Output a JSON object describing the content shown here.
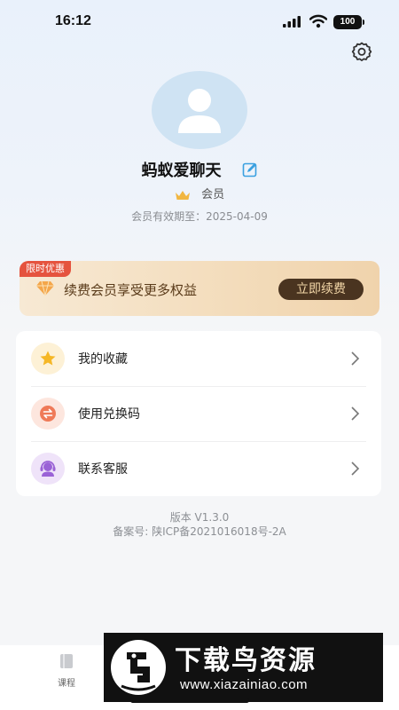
{
  "status_bar": {
    "time": "16:12",
    "battery": "100"
  },
  "profile": {
    "username": "蚂蚁爱聊天",
    "member_label": "会员",
    "expiry": "会员有效期至：2025-04-09"
  },
  "promo": {
    "tag": "限时优惠",
    "text": "续费会员享受更多权益",
    "button": "立即续费"
  },
  "menu": {
    "items": [
      {
        "label": "我的收藏",
        "icon": "star-icon"
      },
      {
        "label": "使用兑换码",
        "icon": "exchange-icon"
      },
      {
        "label": "联系客服",
        "icon": "customer-service-icon"
      }
    ]
  },
  "footer": {
    "version": "版本 V1.3.0",
    "icp": "备案号:  陕ICP备2021016018号-2A"
  },
  "tab_bar": {
    "course_label": "课程"
  },
  "watermark": {
    "title": "下载鸟资源",
    "url": "www.xiazainiao.com"
  },
  "colors": {
    "accent_blue": "#3aa0e0",
    "promo_tag": "#e5533e",
    "renew_button": "#4a3420",
    "renew_text": "#f3d7a8"
  }
}
